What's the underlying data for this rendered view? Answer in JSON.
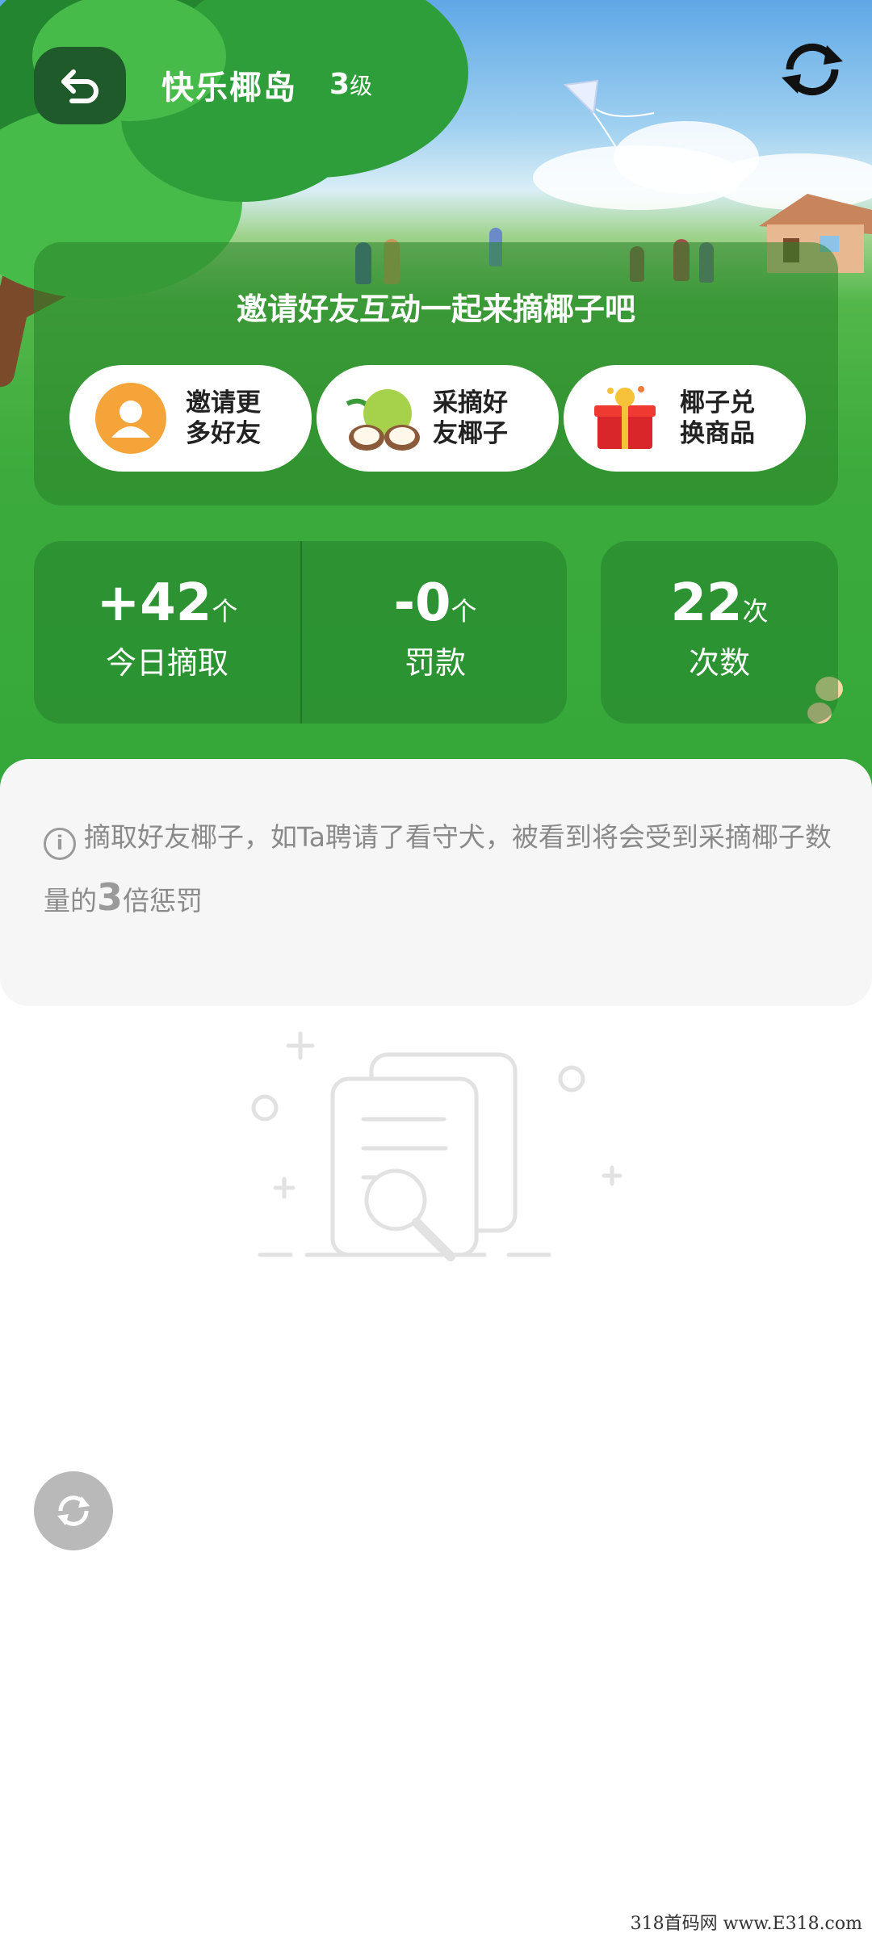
{
  "header": {
    "title": "快乐椰岛",
    "level_num": "3",
    "level_unit": "级"
  },
  "invite": {
    "title": "邀请好友互动一起来摘椰子吧",
    "cards": [
      {
        "line1": "邀请更",
        "line2": "多好友"
      },
      {
        "line1": "采摘好",
        "line2": "友椰子"
      },
      {
        "line1": "椰子兑",
        "line2": "换商品"
      }
    ]
  },
  "stats": [
    {
      "value": "+42",
      "unit": "个",
      "label": "今日摘取"
    },
    {
      "value": "-0",
      "unit": "个",
      "label": "罚款"
    },
    {
      "value": "22",
      "unit": "次",
      "label": "次数"
    }
  ],
  "notice": {
    "text_before": "摘取好友椰子，如Ta聘请了看守犬，被看到将会受到采摘椰子数量的",
    "multiplier": "3",
    "text_after": "倍惩罚"
  },
  "watermark": "318首码网 www.E318.com",
  "colors": {
    "grass": "#3caa3c",
    "panel": "#1f5a2a",
    "notice_bg": "#f6f6f6",
    "float_button": "#b9b9b9"
  },
  "icons": [
    "back-icon",
    "refresh-icon",
    "user-icon",
    "coconut-icon",
    "gift-box-icon",
    "info-icon",
    "empty-document-search-icon"
  ]
}
